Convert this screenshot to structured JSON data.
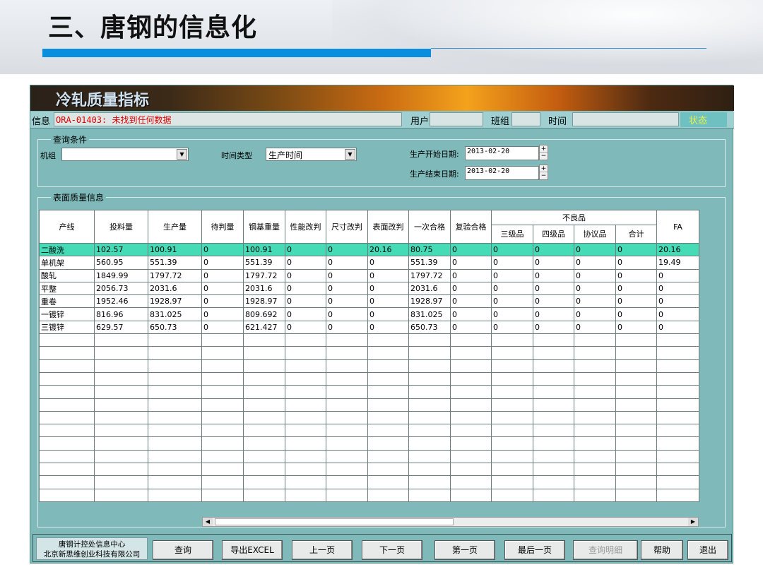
{
  "slide": {
    "title": "三、唐钢的信息化"
  },
  "app": {
    "banner_title": "冷轧质量指标",
    "info_label": "信息",
    "message": "ORA-01403: 未找到任何数据",
    "user_label": "用户",
    "team_label": "班组",
    "time_label": "时间",
    "status_label": "状态"
  },
  "query": {
    "legend": "查询条件",
    "unit_label": "机组",
    "unit_value": "",
    "time_type_label": "时间类型",
    "time_type_value": "生产时间",
    "start_label": "生产开始日期:",
    "start_value": "2013-02-20",
    "end_label": "生产结束日期:",
    "end_value": "2013-02-20"
  },
  "surface": {
    "legend": "表面质量信息"
  },
  "table": {
    "headers": [
      "产线",
      "投料量",
      "生产量",
      "待判量",
      "钢基重量",
      "性能改判",
      "尺寸改判",
      "表面改判",
      "一次合格",
      "复验合格",
      "不良品",
      "FA"
    ],
    "sub_headers": [
      "三级品",
      "四级品",
      "协议品",
      "合计"
    ],
    "rows": [
      [
        "二酸洗",
        "102.57",
        "100.91",
        "0",
        "100.91",
        "0",
        "0",
        "20.16",
        "80.75",
        "0",
        "0",
        "0",
        "0",
        "0",
        "20.16"
      ],
      [
        "单机架",
        "560.95",
        "551.39",
        "0",
        "551.39",
        "0",
        "0",
        "0",
        "551.39",
        "0",
        "0",
        "0",
        "0",
        "0",
        "19.49"
      ],
      [
        "酸轧",
        "1849.99",
        "1797.72",
        "0",
        "1797.72",
        "0",
        "0",
        "0",
        "1797.72",
        "0",
        "0",
        "0",
        "0",
        "0",
        "0"
      ],
      [
        "平整",
        "2056.73",
        "2031.6",
        "0",
        "2031.6",
        "0",
        "0",
        "0",
        "2031.6",
        "0",
        "0",
        "0",
        "0",
        "0",
        "0"
      ],
      [
        "重卷",
        "1952.46",
        "1928.97",
        "0",
        "1928.97",
        "0",
        "0",
        "0",
        "1928.97",
        "0",
        "0",
        "0",
        "0",
        "0",
        "0"
      ],
      [
        "一镀锌",
        "816.96",
        "831.025",
        "0",
        "809.692",
        "0",
        "0",
        "0",
        "831.025",
        "0",
        "0",
        "0",
        "0",
        "0",
        "0"
      ],
      [
        "三镀锌",
        "629.57",
        "650.73",
        "0",
        "621.427",
        "0",
        "0",
        "0",
        "650.73",
        "0",
        "0",
        "0",
        "0",
        "0",
        "0"
      ]
    ]
  },
  "footer": {
    "company_line1": "唐钢计控处信息中心",
    "company_line2": "北京新思维创业科技有限公司",
    "buttons": [
      "查询",
      "导出EXCEL",
      "上一页",
      "下一页",
      "第一页",
      "最后一页",
      "查询明细",
      "帮助",
      "退出"
    ]
  }
}
